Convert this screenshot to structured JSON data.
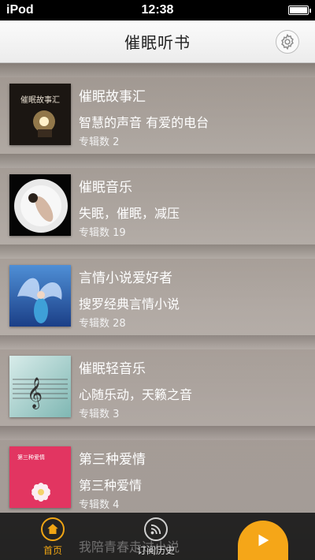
{
  "status_bar": {
    "carrier": "iPod",
    "time": "12:38"
  },
  "nav": {
    "title": "催眠听书",
    "settings_icon": "gear-icon"
  },
  "list": [
    {
      "title": "催眠故事汇",
      "subtitle": "智慧的声音 有爱的电台",
      "count": "专辑数 2",
      "cover_text": "催眠故事汇"
    },
    {
      "title": "催眠音乐",
      "subtitle": "失眠，催眠，减压",
      "count": "专辑数 19"
    },
    {
      "title": "言情小说爱好者",
      "subtitle": "搜罗经典言情小说",
      "count": "专辑数 28"
    },
    {
      "title": "催眠轻音乐",
      "subtitle": "心随乐动，天籁之音",
      "count": "专辑数 3"
    },
    {
      "title": "第三种爱情",
      "subtitle": "第三种爱情",
      "count": "专辑数 4",
      "cover_text": "第三种爱情"
    }
  ],
  "peek_row": {
    "title": "我陪青春走过小说"
  },
  "tabs": [
    {
      "label": "首页",
      "icon": "home-icon",
      "active": true
    },
    {
      "label": "订阅历史",
      "icon": "rss-icon",
      "active": false
    }
  ],
  "colors": {
    "accent": "#f5a618",
    "nav_bg": "#f4f4f4",
    "tab_bar_bg": "#141414"
  }
}
